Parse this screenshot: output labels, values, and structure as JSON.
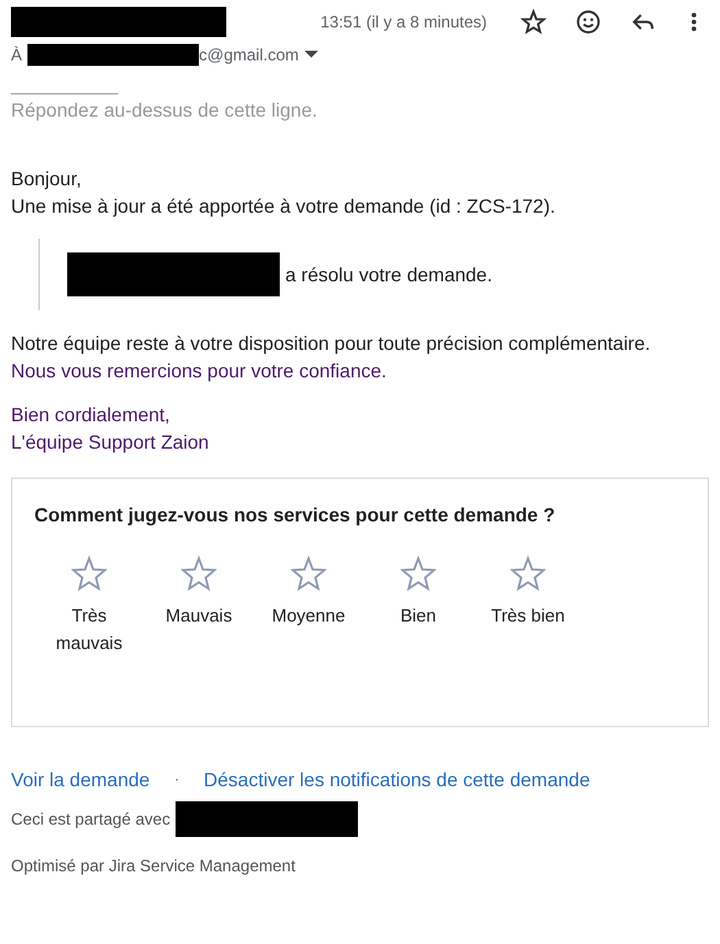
{
  "header": {
    "time": "13:51 (il y a 8 minutes)",
    "recipient_prefix": "À",
    "recipient_suffix": "c@gmail.com"
  },
  "separator": "__________",
  "reply_hint": "Répondez au-dessus de cette ligne.",
  "greeting": "Bonjour,",
  "intro": "Une mise à jour a été apportée à votre demande (id : ZCS-172).",
  "quote": "a résolu votre demande.",
  "closing": [
    "Notre équipe reste à votre disposition pour toute précision complémentaire.",
    "Nous vous remercions pour votre confiance."
  ],
  "signature": [
    "Bien cordialement,",
    "L'équipe Support Zaion"
  ],
  "survey": {
    "question": "Comment jugez-vous nos services pour cette demande ?",
    "stars": 0,
    "options": [
      "Très mauvais",
      "Mauvais",
      "Moyenne",
      "Bien",
      "Très bien"
    ]
  },
  "links": [
    "Voir la demande",
    "Désactiver les notifications de cette demande"
  ],
  "link_separator": "·",
  "shared_with": "Ceci est partagé avec",
  "powered_by": "Optimisé par Jira Service Management"
}
